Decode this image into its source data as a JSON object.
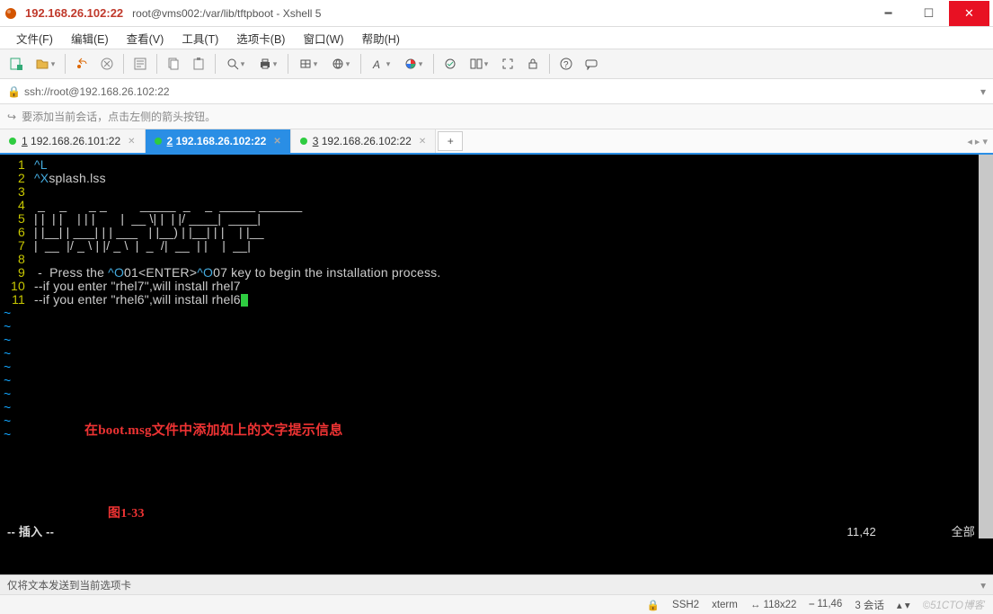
{
  "window": {
    "host_label": "192.168.26.102:22",
    "title_suffix": "root@vms002:/var/lib/tftpboot - Xshell 5"
  },
  "menu": {
    "file": "文件(F)",
    "edit": "编辑(E)",
    "view": "查看(V)",
    "tools": "工具(T)",
    "tab": "选项卡(B)",
    "window": "窗口(W)",
    "help": "帮助(H)"
  },
  "address": "ssh://root@192.168.26.102:22",
  "hint": "要添加当前会话，点击左侧的箭头按钮。",
  "tabs": [
    {
      "num": "1",
      "label": "192.168.26.101:22",
      "active": false
    },
    {
      "num": "2",
      "label": "192.168.26.102:22",
      "active": true
    },
    {
      "num": "3",
      "label": "192.168.26.102:22",
      "active": false
    }
  ],
  "editor": {
    "lines": [
      {
        "n": "1",
        "text": "^L",
        "cls": "term-cyan"
      },
      {
        "n": "2",
        "seg": [
          {
            "t": "^X",
            "c": "term-cyan"
          },
          {
            "t": "splash.lss",
            "c": ""
          }
        ]
      },
      {
        "n": "3",
        "text": ""
      },
      {
        "n": "4",
        "text": " _    _      _ _         _____  _    _  _____ ______ "
      },
      {
        "n": "5",
        "text": "| |  | |    | | |       |  __ \\| |  | |/ ____|  ____|"
      },
      {
        "n": "6",
        "text": "| |__| | ___| | | ___   | |__) | |__| | |    | |__   "
      },
      {
        "n": "7",
        "text": "|  __  |/ _ \\ | |/ _ \\  |  _  /|  __  | |    |  __|  "
      },
      {
        "n": "8",
        "text": ""
      },
      {
        "n": "9",
        "seg": [
          {
            "t": " -  Press the ",
            "c": ""
          },
          {
            "t": "^O",
            "c": "term-cyan"
          },
          {
            "t": "01<ENTER>",
            "c": ""
          },
          {
            "t": "^O",
            "c": "term-cyan"
          },
          {
            "t": "07 key to begin the installation process.",
            "c": ""
          }
        ]
      },
      {
        "n": "10",
        "text": "--if you enter \"rhel7\",will install rhel7"
      },
      {
        "n": "11",
        "text": "--if you enter \"rhel6\",will install rhel6",
        "cursor": true
      }
    ],
    "tilde_count": 10,
    "mode": "-- 插入 --",
    "figure_label": "图1-33",
    "ruler": "11,42",
    "scroll": "全部",
    "note": "在boot.msg文件中添加如上的文字提示信息"
  },
  "footer": {
    "send_hint": "仅将文本发送到当前选项卡",
    "proto": "SSH2",
    "term": "xterm",
    "size": "118x22",
    "pos": "11,46",
    "sessions": "3 会话",
    "watermark": "©51CTO博客"
  }
}
